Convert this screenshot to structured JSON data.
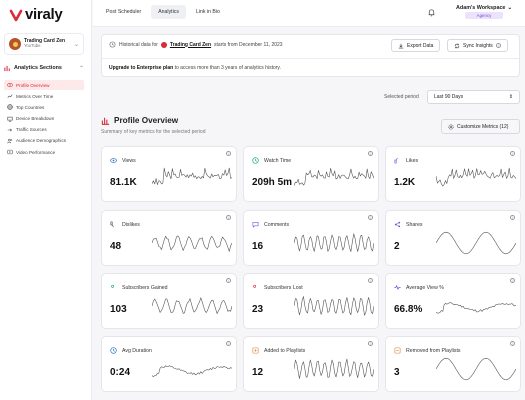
{
  "brand": {
    "name": "viraly",
    "accent": "#d72c3b"
  },
  "account": {
    "name": "Trading Card Zen",
    "platform": "YouTube"
  },
  "sidebar": {
    "section_title": "Analytics Sections",
    "items": [
      {
        "label": "Profile Overview",
        "icon": "eye-icon",
        "active": true
      },
      {
        "label": "Metrics Over Time",
        "icon": "trend-icon"
      },
      {
        "label": "Top Countries",
        "icon": "globe-icon"
      },
      {
        "label": "Device Breakdown",
        "icon": "device-icon"
      },
      {
        "label": "Traffic Sources",
        "icon": "traffic-icon"
      },
      {
        "label": "Audience Demographics",
        "icon": "users-icon"
      },
      {
        "label": "Video Performance",
        "icon": "video-icon"
      }
    ]
  },
  "topbar": {
    "tabs": [
      {
        "label": "Post Scheduler"
      },
      {
        "label": "Analytics",
        "active": true
      },
      {
        "label": "Link in Bio"
      }
    ],
    "workspace": "Adam's Workspace",
    "plan_badge": "Agency"
  },
  "banner": {
    "history_prefix": "Historical data for",
    "history_channel": "Trading Card Zen",
    "history_suffix": "starts from December 11, 2023",
    "export_label": "Export Data",
    "sync_label": "Sync Insights",
    "upgrade_bold": "Upgrade to Enterprise plan",
    "upgrade_rest": "to access more than 3 years of analytics history."
  },
  "period": {
    "label": "Selected period",
    "value": "Last 90 Days"
  },
  "overview": {
    "title": "Profile Overview",
    "subtitle": "Summary of key metrics for the selected period",
    "customize_label": "Customize Metrics (12)"
  },
  "metrics": [
    {
      "label": "Views",
      "value": "81.1K",
      "icon": "eye-icon",
      "color": "#2f6fd6",
      "shape": "spiky"
    },
    {
      "label": "Watch Time",
      "value": "209h 5m",
      "icon": "clock-icon",
      "color": "#1aa77a",
      "shape": "spiky"
    },
    {
      "label": "Likes",
      "value": "1.2K",
      "icon": "thumbs-up-icon",
      "color": "#6b4fd6",
      "shape": "spiky"
    },
    {
      "label": "Dislikes",
      "value": "48",
      "icon": "thumbs-down-icon",
      "color": "#444444",
      "shape": "wavy"
    },
    {
      "label": "Comments",
      "value": "16",
      "icon": "comment-icon",
      "color": "#8a4fd6",
      "shape": "dense"
    },
    {
      "label": "Shares",
      "value": "2",
      "icon": "share-icon",
      "color": "#6b4fd6",
      "shape": "humps"
    },
    {
      "label": "Subscribers Gained",
      "value": "103",
      "icon": "user-plus-icon",
      "color": "#1aa77a",
      "shape": "wavy"
    },
    {
      "label": "Subscribers Lost",
      "value": "23",
      "icon": "user-minus-icon",
      "color": "#d72c3b",
      "shape": "dense"
    },
    {
      "label": "Average View %",
      "value": "66.8%",
      "icon": "pulse-icon",
      "color": "#6b4fd6",
      "shape": "gentle"
    },
    {
      "label": "Avg Duration",
      "value": "0:24",
      "icon": "clock-icon",
      "color": "#2f6fd6",
      "shape": "gentle"
    },
    {
      "label": "Added to Playlists",
      "value": "12",
      "icon": "playlist-add-icon",
      "color": "#e07a2f",
      "shape": "dense"
    },
    {
      "label": "Removed from Playlists",
      "value": "3",
      "icon": "playlist-remove-icon",
      "color": "#e07a2f",
      "shape": "humps"
    }
  ]
}
